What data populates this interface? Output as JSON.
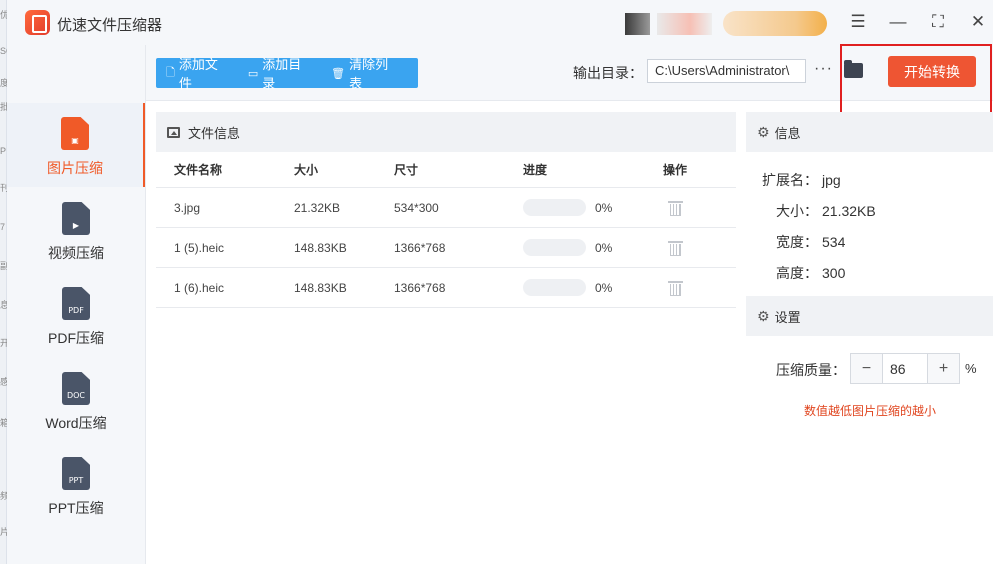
{
  "app": {
    "title": "优速文件压缩器"
  },
  "window_controls": [
    "menu-icon",
    "minimize-icon",
    "maximize-icon",
    "close-icon"
  ],
  "edge_text": [
    "优",
    "SC",
    "度",
    "批",
    "P",
    "刊",
    "7",
    "副",
    "息",
    "开",
    "感",
    "箱",
    "频",
    "片"
  ],
  "sidebar": {
    "items": [
      {
        "label": "图片压缩",
        "icon": "image-file-icon",
        "glyph": "▣",
        "active": true
      },
      {
        "label": "视频压缩",
        "icon": "video-file-icon",
        "glyph": "▶",
        "active": false
      },
      {
        "label": "PDF压缩",
        "icon": "pdf-file-icon",
        "glyph": "PDF",
        "active": false
      },
      {
        "label": "Word压缩",
        "icon": "doc-file-icon",
        "glyph": "DOC",
        "active": false
      },
      {
        "label": "PPT压缩",
        "icon": "ppt-file-icon",
        "glyph": "PPT",
        "active": false
      }
    ]
  },
  "toolbar": {
    "add_file": "添加文件",
    "add_folder": "添加目录",
    "clear_list": "清除列表",
    "output_label": "输出目录：",
    "output_path": "C:\\Users\\Administrator\\",
    "more": "···",
    "start": "开始转换"
  },
  "files": {
    "header": "文件信息",
    "columns": [
      "文件名称",
      "大小",
      "尺寸",
      "进度",
      "操作"
    ],
    "rows": [
      {
        "name": "3.jpg",
        "size": "21.32KB",
        "dim": "534*300",
        "progress": 0,
        "progress_text": "0%"
      },
      {
        "name": "1 (5).heic",
        "size": "148.83KB",
        "dim": "1366*768",
        "progress": 0,
        "progress_text": "0%"
      },
      {
        "name": "1 (6).heic",
        "size": "148.83KB",
        "dim": "1366*768",
        "progress": 0,
        "progress_text": "0%"
      }
    ]
  },
  "info": {
    "header": "信息",
    "ext_label": "扩展名：",
    "ext": "jpg",
    "size_label": "大小：",
    "size": "21.32KB",
    "width_label": "宽度：",
    "width": "534",
    "height_label": "高度：",
    "height": "300"
  },
  "settings": {
    "header": "设置",
    "quality_label": "压缩质量：",
    "minus": "−",
    "quality": "86",
    "plus": "+",
    "unit": "%",
    "hint": "数值越低图片压缩的越小"
  },
  "colors": {
    "accent": "#3aa4f0",
    "brand": "#ee5533",
    "highlight": "#e02020"
  }
}
